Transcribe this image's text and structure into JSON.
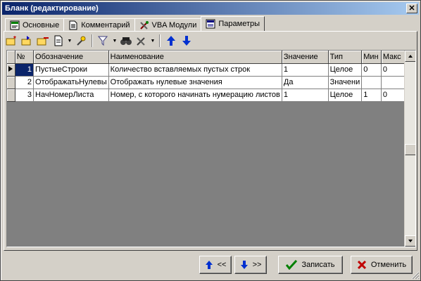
{
  "window": {
    "title": "Бланк (редактирование)",
    "close_glyph": "✕"
  },
  "tabs": [
    {
      "label": "Основные",
      "icon": "form-icon"
    },
    {
      "label": "Комментарий",
      "icon": "document-icon"
    },
    {
      "label": "VBA Модули",
      "icon": "tools-icon"
    },
    {
      "label": "Параметры",
      "icon": "parameters-icon",
      "active": true
    }
  ],
  "toolbar": {
    "items": [
      "add-row-icon",
      "insert-row-icon",
      "delete-row-icon",
      "document-icon",
      "settings-icon",
      "filter-icon",
      "find-icon",
      "tools-icon",
      "move-up-icon",
      "move-down-icon"
    ]
  },
  "grid": {
    "columns": [
      "№",
      "Обозначение",
      "Наименование",
      "Значение",
      "Тип",
      "Мин",
      "Макс"
    ],
    "rows": [
      {
        "num": "1",
        "name": "ПустыеСтроки",
        "title": "Количество вставляемых пустых строк",
        "value": "1",
        "type": "Целое",
        "min": "0",
        "max": "0",
        "current": true
      },
      {
        "num": "2",
        "name": "ОтображатьНулевы",
        "title": "Отображать нулевые значения",
        "value": "Да",
        "type": "Значени",
        "min": "",
        "max": ""
      },
      {
        "num": "3",
        "name": "НачНомерЛиста",
        "title": "Номер, с которого начинать нумерацию листов",
        "value": "1",
        "type": "Целое",
        "min": "1",
        "max": "0"
      }
    ]
  },
  "buttons": {
    "prev": "<<",
    "next": ">>",
    "save": "Записать",
    "cancel": "Отменить"
  },
  "colors": {
    "selection": "#0a246a",
    "titlebar": "#0a246a",
    "face": "#d4d0c8"
  }
}
